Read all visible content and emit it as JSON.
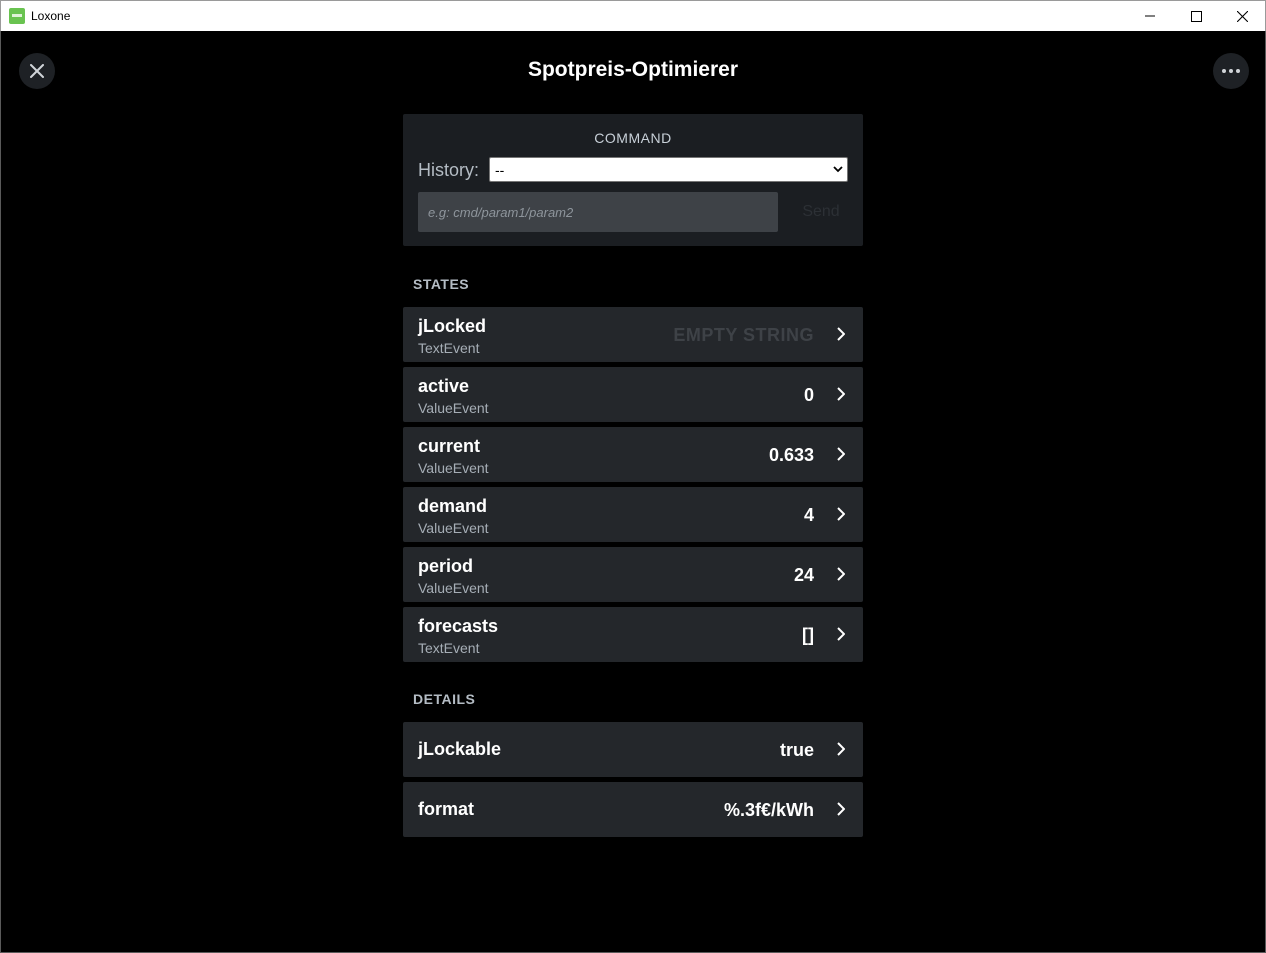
{
  "window": {
    "title": "Loxone"
  },
  "page": {
    "title": "Spotpreis-Optimierer"
  },
  "command": {
    "header": "COMMAND",
    "history_label": "History:",
    "history_selected": "--",
    "input_placeholder": "e.g: cmd/param1/param2",
    "send_label": "Send"
  },
  "states": {
    "label": "STATES",
    "items": [
      {
        "name": "jLocked",
        "type": "TextEvent",
        "value": "EMPTY STRING"
      },
      {
        "name": "active",
        "type": "ValueEvent",
        "value": "0"
      },
      {
        "name": "current",
        "type": "ValueEvent",
        "value": "0.633"
      },
      {
        "name": "demand",
        "type": "ValueEvent",
        "value": "4"
      },
      {
        "name": "period",
        "type": "ValueEvent",
        "value": "24"
      },
      {
        "name": "forecasts",
        "type": "TextEvent",
        "value": "[]"
      }
    ]
  },
  "details": {
    "label": "DETAILS",
    "items": [
      {
        "name": "jLockable",
        "value": "true"
      },
      {
        "name": "format",
        "value": "%.3f€/kWh"
      }
    ]
  },
  "colors": {
    "background": "#000000",
    "card": "#24272b",
    "command_card": "#1b1e22",
    "logo_green": "#69c350"
  }
}
